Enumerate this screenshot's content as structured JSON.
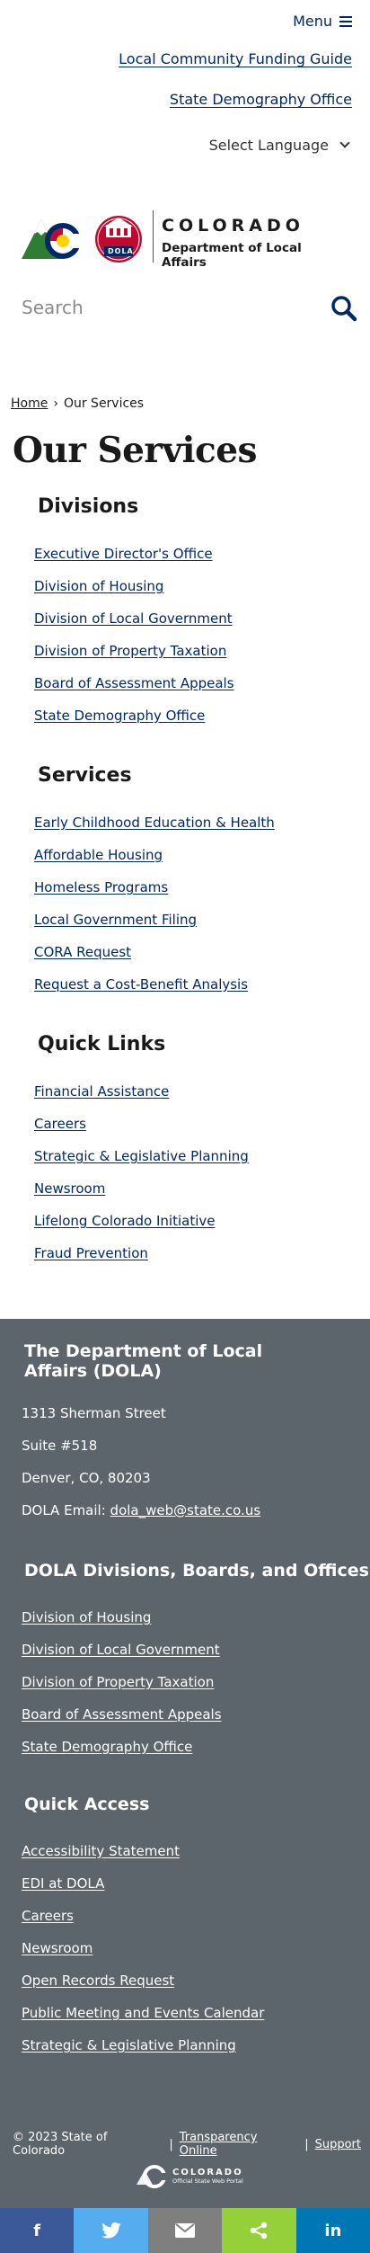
{
  "header": {
    "menu_label": "Menu",
    "top_links": [
      "Local Community Funding Guide",
      "State Demography Office"
    ],
    "language_label": "Select Language"
  },
  "logo": {
    "name": "COLORADO",
    "department": "Department of Local Affairs",
    "badge": "DOLA"
  },
  "search": {
    "placeholder": "Search"
  },
  "breadcrumb": {
    "home": "Home",
    "separator": "›",
    "current": "Our Services"
  },
  "page": {
    "title": "Our Services"
  },
  "sections": [
    {
      "heading": "Divisions",
      "links": [
        "Executive Director's Office",
        "Division of Housing",
        "Division of Local Government",
        "Division of Property Taxation",
        "Board of Assessment Appeals",
        "State Demography Office"
      ]
    },
    {
      "heading": "Services",
      "links": [
        "Early Childhood Education & Health",
        "Affordable Housing",
        "Homeless Programs",
        "Local Government Filing",
        "CORA Request",
        "Request a Cost-Benefit Analysis"
      ]
    },
    {
      "heading": "Quick Links",
      "links": [
        "Financial Assistance",
        "Careers",
        "Strategic & Legislative Planning",
        "Newsroom",
        "Lifelong Colorado Initiative",
        "Fraud Prevention"
      ]
    }
  ],
  "footer": {
    "org_heading": "The Department of Local Affairs (DOLA)",
    "address_line1": "1313 Sherman Street",
    "address_line2": "Suite  #518",
    "address_line3": "Denver, CO, 80203",
    "email_label": "DOLA Email:",
    "email": "dola_web@state.co.us",
    "divisions_heading": "DOLA Divisions, Boards, and Offices",
    "divisions": [
      "Division of Housing",
      "Division of Local Government",
      "Division of Property Taxation",
      "Board of Assessment Appeals",
      "State Demography Office"
    ],
    "quick_heading": "Quick Access",
    "quick": [
      "Accessibility Statement",
      "EDI at DOLA",
      "Careers",
      "Newsroom",
      "Open Records Request",
      "Public Meeting and Events Calendar",
      "Strategic & Legislative Planning"
    ],
    "copyright": "© 2023 State of Colorado",
    "sep": "|",
    "transparency": "Transparency Online",
    "support": "Support",
    "portal_name": "COLORADO",
    "portal_sub": "Official State Web Portal"
  },
  "share": {
    "facebook": "f",
    "twitter": "twitter-icon",
    "email": "email-icon",
    "share": "share-icon",
    "linkedin": "in"
  },
  "colors": {
    "link": "#002868",
    "footer_bg": "#5d656c",
    "facebook": "#3b5998",
    "twitter": "#55acee",
    "email": "#7f7f7f",
    "share": "#95d03a",
    "linkedin": "#0077b5"
  }
}
